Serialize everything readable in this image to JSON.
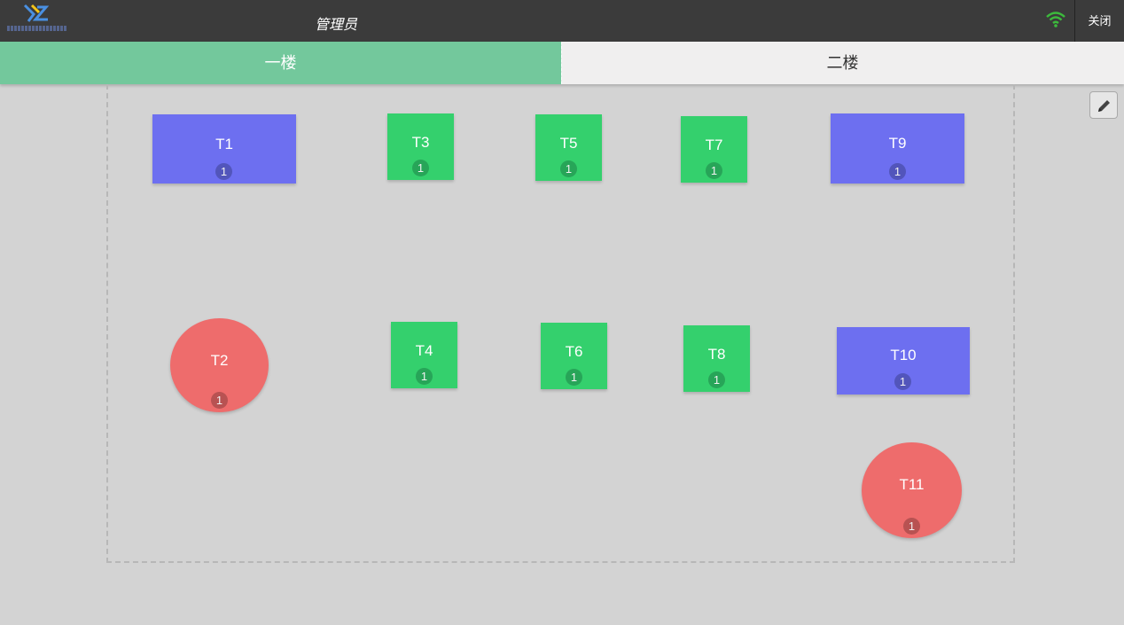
{
  "header": {
    "user_title": "管理员",
    "close_label": "关闭",
    "wifi_icon": "wifi-icon",
    "wifi_color": "#3cba3c"
  },
  "tabs": [
    {
      "label": "一楼",
      "active": true
    },
    {
      "label": "二楼",
      "active": false
    }
  ],
  "toolbar": {
    "edit_icon": "pencil-icon"
  },
  "tables": [
    {
      "name": "T1",
      "count": "1",
      "shape": "rect",
      "color": "#6d6ff0"
    },
    {
      "name": "T2",
      "count": "1",
      "shape": "round",
      "color": "#ee6c6c"
    },
    {
      "name": "T3",
      "count": "1",
      "shape": "square",
      "color": "#34d06d"
    },
    {
      "name": "T4",
      "count": "1",
      "shape": "square",
      "color": "#34d06d"
    },
    {
      "name": "T5",
      "count": "1",
      "shape": "square",
      "color": "#34d06d"
    },
    {
      "name": "T6",
      "count": "1",
      "shape": "square",
      "color": "#34d06d"
    },
    {
      "name": "T7",
      "count": "1",
      "shape": "square",
      "color": "#34d06d"
    },
    {
      "name": "T8",
      "count": "1",
      "shape": "square",
      "color": "#34d06d"
    },
    {
      "name": "T9",
      "count": "1",
      "shape": "rect",
      "color": "#6d6ff0"
    },
    {
      "name": "T10",
      "count": "1",
      "shape": "rect",
      "color": "#6d6ff0"
    },
    {
      "name": "T11",
      "count": "1",
      "shape": "round",
      "color": "#ee6c6c"
    }
  ]
}
